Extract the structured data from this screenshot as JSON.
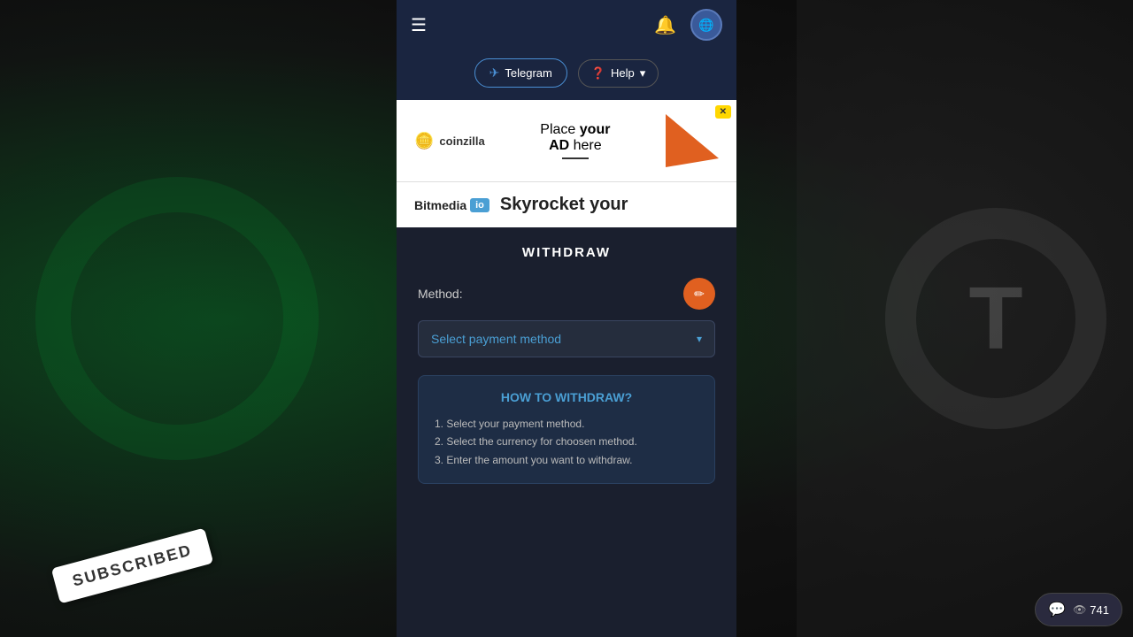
{
  "background": {
    "color": "#1a2a1a"
  },
  "navbar": {
    "hamburger_label": "☰",
    "bell_label": "🔔",
    "avatar_label": "🌐"
  },
  "sub_header": {
    "telegram_label": "Telegram",
    "help_label": "Help",
    "chevron": "▾"
  },
  "ad1": {
    "coinzilla_name": "coinzilla",
    "coinzilla_coin": "🪙",
    "place_text": "Place",
    "your_text": "your",
    "ad_text": "AD",
    "here_text": "here",
    "close_label": "✕"
  },
  "ad2": {
    "bitmedia_label": "Bitmedia",
    "io_label": "io",
    "slogan": "Skyrocket your"
  },
  "withdraw": {
    "title": "WITHDRAW",
    "method_label": "Method:",
    "edit_icon": "✏",
    "select_placeholder": "Select payment method",
    "select_chevron": "▾"
  },
  "how_to": {
    "title": "HOW TO WITHDRAW?",
    "steps": [
      "1. Select your payment method.",
      "2. Select the currency for choosen method.",
      "3. Enter the amount you want to withdraw."
    ]
  },
  "subscribed_badge": {
    "label": "SUBSCRIBED"
  },
  "live_chat": {
    "chat_icon": "💬",
    "viewer_icon": "👁",
    "count": "741"
  }
}
